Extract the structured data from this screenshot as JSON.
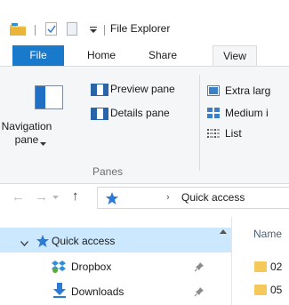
{
  "window": {
    "title": "File Explorer"
  },
  "ribbon_tabs": [
    {
      "label": "File"
    },
    {
      "label": "Home"
    },
    {
      "label": "Share"
    },
    {
      "label": "View"
    }
  ],
  "ribbon": {
    "navigation_pane_label_line1": "Navigation",
    "navigation_pane_label_line2": "pane",
    "preview_pane_label": "Preview pane",
    "details_pane_label": "Details pane",
    "panes_group_label": "Panes",
    "layout_extra_large": "Extra larg",
    "layout_medium": "Medium i",
    "layout_list": "List"
  },
  "address_bar": {
    "location": "Quick access"
  },
  "navigation_pane": {
    "items": [
      {
        "label": "Quick access",
        "icon": "star-icon",
        "selected": true
      },
      {
        "label": "Dropbox",
        "icon": "dropbox-icon",
        "pinned": true
      },
      {
        "label": "Downloads",
        "icon": "download-icon",
        "pinned": true
      }
    ]
  },
  "content": {
    "column_name": "Name",
    "files": [
      {
        "name": "02"
      },
      {
        "name": "05"
      }
    ]
  },
  "colors": {
    "accent": "#1979ca",
    "selection": "#cce8ff",
    "ribbon_bg": "#f5f6f7",
    "folder": "#f4c859"
  }
}
